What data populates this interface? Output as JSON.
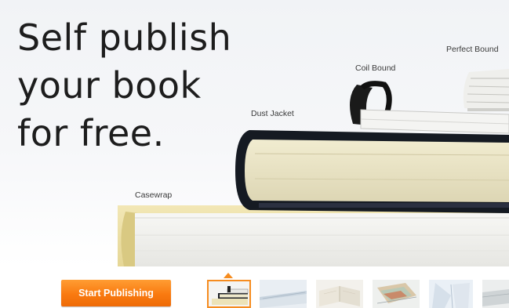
{
  "hero": {
    "headline_lines": [
      "Self publish",
      "your book",
      "for free."
    ],
    "book_labels": {
      "casewrap": "Casewrap",
      "dust_jacket": "Dust Jacket",
      "coil_bound": "Coil Bound",
      "perfect_bound": "Perfect Bound"
    }
  },
  "bottom_bar": {
    "start_button_label": "Start Publishing",
    "thumbnails": [
      {
        "name": "book-stack-thumbnail",
        "active": true
      },
      {
        "name": "open-pages-thumbnail",
        "active": false
      },
      {
        "name": "open-book-thumbnail",
        "active": false
      },
      {
        "name": "magazine-thumbnail",
        "active": false
      },
      {
        "name": "binding-thumbnail",
        "active": false
      },
      {
        "name": "cover-thumbnail",
        "active": false
      }
    ]
  },
  "colors": {
    "accent_orange": "#f68c1f",
    "headline_text": "#1d1d1d",
    "background": "#ffffff"
  }
}
